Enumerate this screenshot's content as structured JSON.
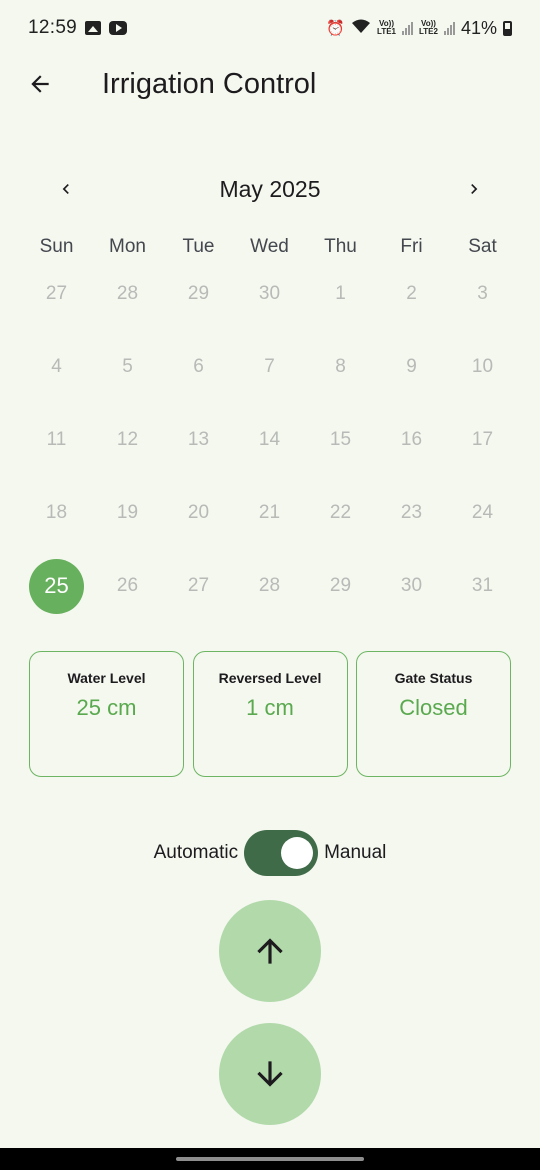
{
  "status_bar": {
    "time": "12:59",
    "battery": "41%",
    "lte1": "LTE1",
    "lte2": "LTE2",
    "volte": "Vo))"
  },
  "app_bar": {
    "title": "Irrigation Control",
    "back_icon": "arrow-left-icon"
  },
  "calendar": {
    "month_label": "May 2025",
    "weekdays": [
      "Sun",
      "Mon",
      "Tue",
      "Wed",
      "Thu",
      "Fri",
      "Sat"
    ],
    "weeks": [
      [
        "27",
        "28",
        "29",
        "30",
        "1",
        "2",
        "3"
      ],
      [
        "4",
        "5",
        "6",
        "7",
        "8",
        "9",
        "10"
      ],
      [
        "11",
        "12",
        "13",
        "14",
        "15",
        "16",
        "17"
      ],
      [
        "18",
        "19",
        "20",
        "21",
        "22",
        "23",
        "24"
      ],
      [
        "25",
        "26",
        "27",
        "28",
        "29",
        "30",
        "31"
      ]
    ],
    "selected_day": "25",
    "selected_color": "#67b05d"
  },
  "cards": [
    {
      "title": "Water Level",
      "value": "25 cm"
    },
    {
      "title": "Reversed Level",
      "value": "1 cm"
    },
    {
      "title": "Gate Status",
      "value": "Closed"
    }
  ],
  "mode": {
    "left_label": "Automatic",
    "right_label": "Manual",
    "toggle_on": true
  },
  "controls": {
    "up_icon": "arrow-up-icon",
    "down_icon": "arrow-down-icon"
  },
  "colors": {
    "background": "#f4f8ef",
    "accent": "#67b05d",
    "card_value": "#5aa94f",
    "switch_track": "#3f6b48",
    "round_button": "#b1d9aa"
  }
}
